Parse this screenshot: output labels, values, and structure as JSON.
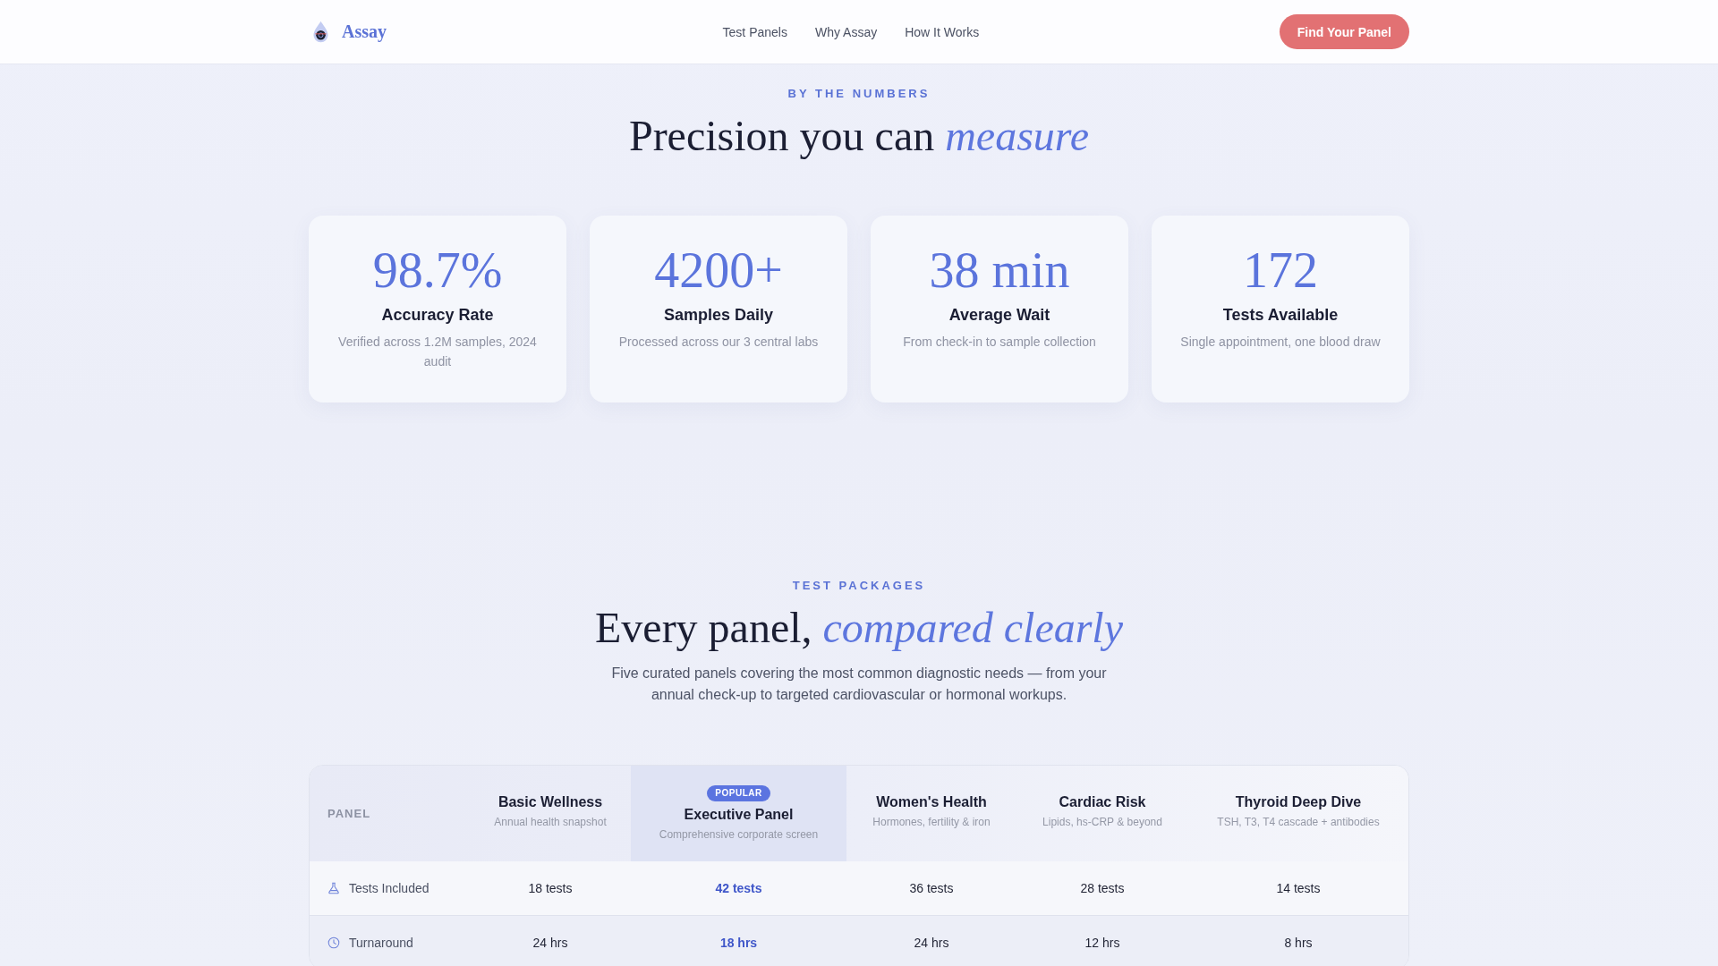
{
  "header": {
    "brand": "Assay",
    "links": [
      "Test Panels",
      "Why Assay",
      "How It Works"
    ],
    "cta": "Find Your Panel"
  },
  "stats_section": {
    "eyebrow": "BY THE NUMBERS",
    "heading": "Precision you can *measure*",
    "stats": [
      {
        "value": "98.7%",
        "label": "Accuracy Rate",
        "description": "Verified across 1.2M samples, 2024 audit"
      },
      {
        "value": "4200+",
        "label": "Samples Daily",
        "description": "Processed across our 3 central labs"
      },
      {
        "value": "38 min",
        "label": "Average Wait",
        "description": "From check-in to sample collection"
      },
      {
        "value": "172",
        "label": "Tests Available",
        "description": "Single appointment, one blood draw"
      }
    ]
  },
  "packages_section": {
    "eyebrow": "TEST PACKAGES",
    "heading": "Every panel, *compared clearly*",
    "description": "Five curated panels covering the most common diagnostic needs — from your annual check-up to targeted cardiovascular or hormonal workups.",
    "table": {
      "header_label": "PANEL",
      "columns": [
        {
          "name": "Basic Wellness",
          "subtitle": "Annual health snapshot",
          "highlighted": false
        },
        {
          "name": "Executive Panel",
          "subtitle": "Comprehensive corporate screen",
          "badge": "POPULAR",
          "highlighted": true
        },
        {
          "name": "Women's Health",
          "subtitle": "Hormones, fertility & iron",
          "highlighted": false
        },
        {
          "name": "Cardiac Risk",
          "subtitle": "Lipids, hs-CRP & beyond",
          "highlighted": false
        },
        {
          "name": "Thyroid Deep Dive",
          "subtitle": "TSH, T3, T4 cascade + antibodies",
          "highlighted": false
        }
      ],
      "rows": [
        {
          "label": "Tests Included",
          "values": [
            "18 tests",
            "42 tests",
            "36 tests",
            "28 tests",
            "14 tests"
          ]
        },
        {
          "label": "Turnaround",
          "values": [
            "24 hrs",
            "18 hrs",
            "24 hrs",
            "12 hrs",
            "8 hrs"
          ]
        }
      ]
    }
  }
}
